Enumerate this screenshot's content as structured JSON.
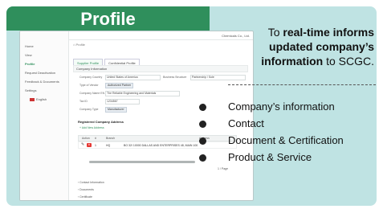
{
  "slide": {
    "title": "Profile",
    "headline_pre": "To ",
    "headline_bold_1": "real-time informs updated company’s information",
    "headline_post": " to SCGC.",
    "bullets": [
      "Company’s information",
      "Contact",
      "Document & Certification",
      "Product & Service"
    ]
  },
  "app": {
    "sidebar": [
      "Home",
      "View",
      "Profile",
      "Request Deactivation",
      "Feedback & Documents",
      "Settings"
    ],
    "lang": "English",
    "user": "Chemicals Co., Ltd.",
    "breadcrumb": "Profile",
    "tabs": [
      "Supplier Profile",
      "Confidential Profile"
    ],
    "sections": {
      "company_info": "Company Information",
      "registered_address": "Registered Company Address",
      "add_address": "+ Add New Address",
      "contact": "Contact Information",
      "documents": "Documents",
      "certificate": "Certificate"
    },
    "fields": [
      {
        "label": "Company Country",
        "value": "United States of America"
      },
      {
        "label": "Business Structure",
        "value": "Partnership / Sole"
      },
      {
        "label": "Type of Vendor",
        "value": "Authorized Partner"
      },
      {
        "label": "Company Name EN",
        "value": "The Reliable Engineering and Materials"
      },
      {
        "label": "Tax ID",
        "value": "1234567"
      },
      {
        "label": "Company Type",
        "value": "Manufacturer"
      }
    ],
    "table": {
      "headers": [
        "Action",
        "#",
        "Branch",
        "Address"
      ],
      "rows": [
        {
          "num": "1",
          "branch": "HQ",
          "address": "BO 32/ 10000 DALLAS AND ENTERPRISES 48, MAIN 100"
        }
      ]
    },
    "pager": "1 / Page"
  }
}
